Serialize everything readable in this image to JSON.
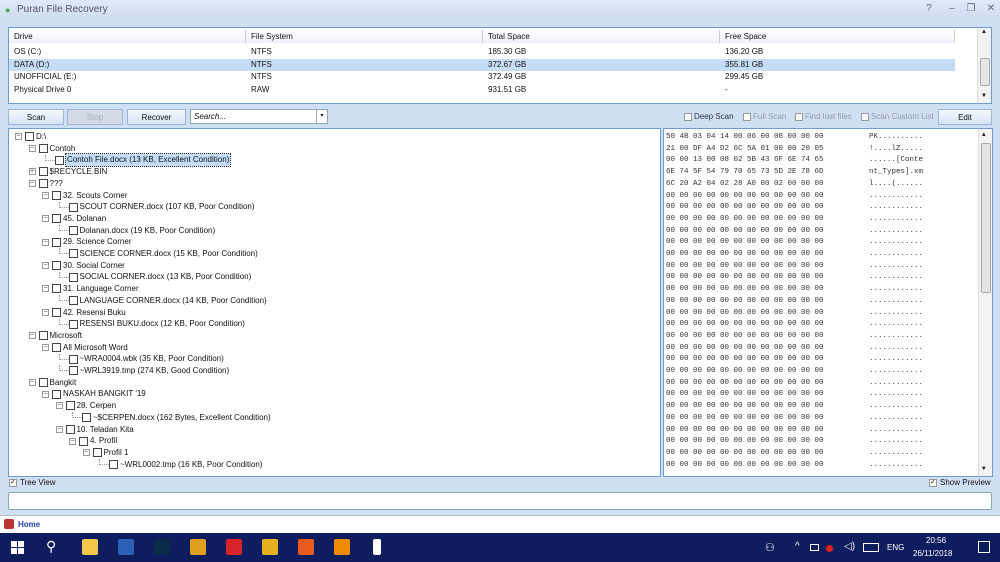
{
  "window": {
    "title": "Puran File Recovery",
    "help": "?",
    "minimize": "–",
    "maximize": "❐",
    "close": "✕"
  },
  "drives": {
    "headers": [
      "Drive",
      "File System",
      "Total Space",
      "Free Space"
    ],
    "rows": [
      [
        "OS (C:)",
        "NTFS",
        "185.30 GB",
        "136.20 GB"
      ],
      [
        "DATA (D:)",
        "NTFS",
        "372.67 GB",
        "355.81 GB"
      ],
      [
        "UNOFFICIAL (E:)",
        "NTFS",
        "372.49 GB",
        "299.45 GB"
      ],
      [
        "Physical Drive 0",
        "RAW",
        "931.51 GB",
        "-"
      ]
    ],
    "selected_index": 1
  },
  "toolbar": {
    "scan": "Scan",
    "stop": "Stop",
    "recover": "Recover",
    "search_placeholder": "Search...",
    "deep_scan": "Deep Scan",
    "full_scan": "Full Scan",
    "find_lost": "Find lost files",
    "scan_custom": "Scan Custom List",
    "edit": "Edit"
  },
  "tree": [
    {
      "l": 0,
      "e": "-",
      "t": "D:\\"
    },
    {
      "l": 1,
      "e": "-",
      "t": "Contoh"
    },
    {
      "l": 2,
      "e": "",
      "t": "Contoh File.docx  (13 KB, Excellent Condition)",
      "sel": true
    },
    {
      "l": 1,
      "e": "+",
      "t": "$RECYCLE.BIN"
    },
    {
      "l": 1,
      "e": "-",
      "t": "???"
    },
    {
      "l": 2,
      "e": "-",
      "t": "32. Scouts Corner"
    },
    {
      "l": 3,
      "e": "",
      "t": "SCOUT CORNER.docx  (107 KB, Poor Condition)"
    },
    {
      "l": 2,
      "e": "-",
      "t": "45. Dolanan"
    },
    {
      "l": 3,
      "e": "",
      "t": "Dolanan.docx  (19 KB, Poor Condition)"
    },
    {
      "l": 2,
      "e": "-",
      "t": "29. Science Corner"
    },
    {
      "l": 3,
      "e": "",
      "t": "SCIENCE CORNER.docx  (15 KB, Poor Condition)"
    },
    {
      "l": 2,
      "e": "-",
      "t": "30. Social Corner"
    },
    {
      "l": 3,
      "e": "",
      "t": "SOCIAL CORNER.docx  (13 KB, Poor Condition)"
    },
    {
      "l": 2,
      "e": "-",
      "t": "31. Language Corner"
    },
    {
      "l": 3,
      "e": "",
      "t": "LANGUAGE CORNER.docx  (14 KB, Poor Condition)"
    },
    {
      "l": 2,
      "e": "-",
      "t": "42. Resensi Buku"
    },
    {
      "l": 3,
      "e": "",
      "t": "RESENSI BUKU.docx  (12 KB, Poor Condition)"
    },
    {
      "l": 1,
      "e": "-",
      "t": "Microsoft"
    },
    {
      "l": 2,
      "e": "-",
      "t": "All Microsoft Word"
    },
    {
      "l": 3,
      "e": "",
      "t": "~WRA0004.wbk  (35 KB, Poor Condition)"
    },
    {
      "l": 3,
      "e": "",
      "t": "~WRL3919.tmp  (274 KB, Good Condition)"
    },
    {
      "l": 1,
      "e": "-",
      "t": "Bangkit"
    },
    {
      "l": 2,
      "e": "-",
      "t": "NASKAH BANGKIT '19"
    },
    {
      "l": 3,
      "e": "-",
      "t": "28. Cerpen"
    },
    {
      "l": 4,
      "e": "",
      "t": "~$CERPEN.docx  (162 Bytes, Excellent Condition)"
    },
    {
      "l": 3,
      "e": "-",
      "t": "10. Teladan Kita"
    },
    {
      "l": 4,
      "e": "-",
      "t": "4. Profil"
    },
    {
      "l": 5,
      "e": "-",
      "t": "Profil 1"
    },
    {
      "l": 6,
      "e": "",
      "t": "~WRL0002.tmp  (16 KB, Poor Condition)"
    }
  ],
  "hex": [
    [
      "50 4B 03 04 14 00 06 00 08 00 00 00",
      "PK.........."
    ],
    [
      "21 00 DF A4 D2 6C 5A 01 00 00 20 05",
      "!....lZ....."
    ],
    [
      "00 00 13 00 08 02 5B 43 6F 6E 74 65",
      "......[Conte"
    ],
    [
      "6E 74 5F 54 79 70 65 73 5D 2E 78 6D",
      "nt_Types].xm"
    ],
    [
      "6C 20 A2 04 02 28 A0 00 02 00 00 00",
      "l....(......"
    ],
    [
      "00 00 00 00 00 00 00 00 00 00 00 00",
      "............"
    ],
    [
      "00 00 00 00 00 00 00 00 00 00 00 00",
      "............"
    ],
    [
      "00 00 00 00 00 00 00 00 00 00 00 00",
      "............"
    ],
    [
      "00 00 00 00 00 00 00 00 00 00 00 00",
      "............"
    ],
    [
      "00 00 00 00 00 00 00 00 00 00 00 00",
      "............"
    ],
    [
      "00 00 00 00 00 00 00 00 00 00 00 00",
      "............"
    ],
    [
      "00 00 00 00 00 00 00 00 00 00 00 00",
      "............"
    ],
    [
      "00 00 00 00 00 00 00 00 00 00 00 00",
      "............"
    ],
    [
      "00 00 00 00 00 00 00 00 00 00 00 00",
      "............"
    ],
    [
      "00 00 00 00 00 00 00 00 00 00 00 00",
      "............"
    ],
    [
      "00 00 00 00 00 00 00 00 00 00 00 00",
      "............"
    ],
    [
      "00 00 00 00 00 00 00 00 00 00 00 00",
      "............"
    ],
    [
      "00 00 00 00 00 00 00 00 00 00 00 00",
      "............"
    ],
    [
      "00 00 00 00 00 00 00 00 00 00 00 00",
      "............"
    ],
    [
      "00 00 00 00 00 00 00 00 00 00 00 00",
      "............"
    ],
    [
      "00 00 00 00 00 00 00 00 00 00 00 00",
      "............"
    ],
    [
      "00 00 00 00 00 00 00 00 00 00 00 00",
      "............"
    ],
    [
      "00 00 00 00 00 00 00 00 00 00 00 00",
      "............"
    ],
    [
      "00 00 00 00 00 00 00 00 00 00 00 00",
      "............"
    ],
    [
      "00 00 00 00 00 00 00 00 00 00 00 00",
      "............"
    ],
    [
      "00 00 00 00 00 00 00 00 00 00 00 00",
      "............"
    ],
    [
      "00 00 00 00 00 00 00 00 00 00 00 00",
      "............"
    ],
    [
      "00 00 00 00 00 00 00 00 00 00 00 00",
      "............"
    ],
    [
      "00 00 00 00 00 00 00 00 00 00 00 00",
      "............"
    ]
  ],
  "bottom": {
    "tree_view": "Tree View",
    "show_preview": "Show Preview",
    "home": "Home"
  },
  "taskbar": {
    "apps": [
      {
        "name": "file-explorer",
        "color": "#f2c74a"
      },
      {
        "name": "word",
        "color": "#2b5fb4"
      },
      {
        "name": "photoshop",
        "color": "#0b2a4a"
      },
      {
        "name": "chrome",
        "color": "#e0a020"
      },
      {
        "name": "download-manager",
        "color": "#d8232a"
      },
      {
        "name": "winamp",
        "color": "#e6b020"
      },
      {
        "name": "xampp",
        "color": "#e85a1e"
      },
      {
        "name": "vlc",
        "color": "#f08a00"
      },
      {
        "name": "puran-file-recovery",
        "color": "#ffffff"
      }
    ],
    "lang": "ENG",
    "time": "20:56",
    "date": "26/11/2018"
  }
}
